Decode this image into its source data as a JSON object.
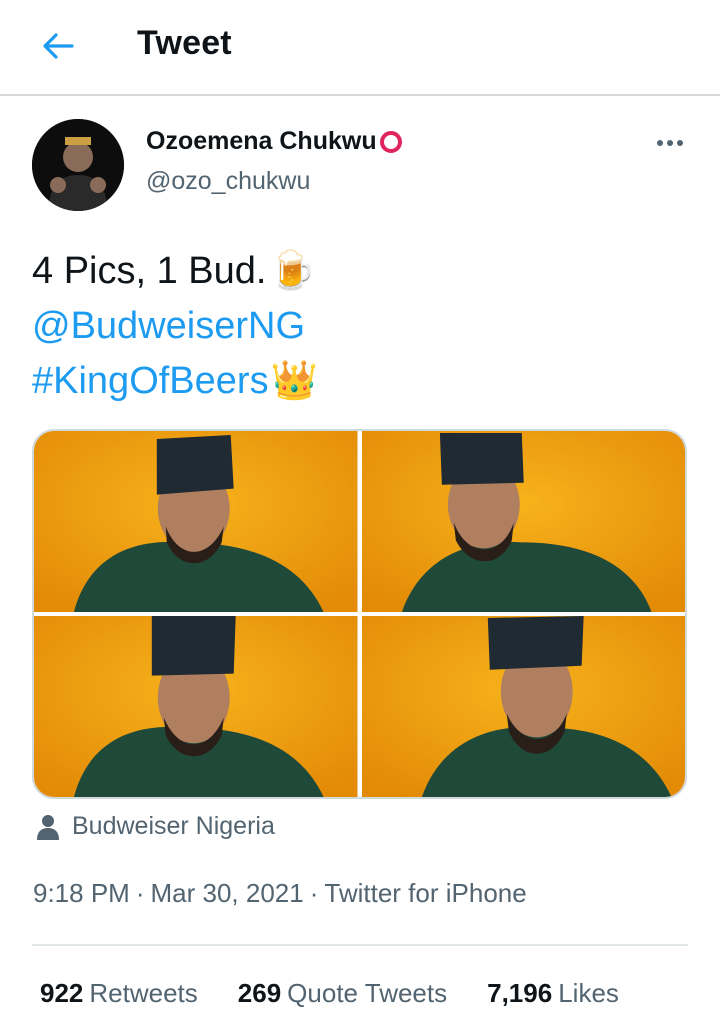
{
  "header": {
    "title": "Tweet",
    "back_icon": "arrow-left-icon",
    "accent": "#1d9bf0"
  },
  "tweet": {
    "author": {
      "name": "Ozoemena Chukwu",
      "handle": "@ozo_chukwu",
      "badge_color": "#e0245e"
    },
    "text": {
      "line1": "4 Pics, 1 Bud.",
      "line1_emoji": "🍺",
      "mention": "@BudweiserNG",
      "hashtag": "#KingOfBeers",
      "hashtag_emoji": "👑"
    },
    "tagged_user": "Budweiser Nigeria",
    "time": "9:18 PM",
    "date": "Mar 30, 2021",
    "source": "Twitter for iPhone",
    "stats": {
      "retweets": "922",
      "retweets_label": "Retweets",
      "quotes": "269",
      "quotes_label": "Quote Tweets",
      "likes": "7,196",
      "likes_label": "Likes"
    }
  }
}
